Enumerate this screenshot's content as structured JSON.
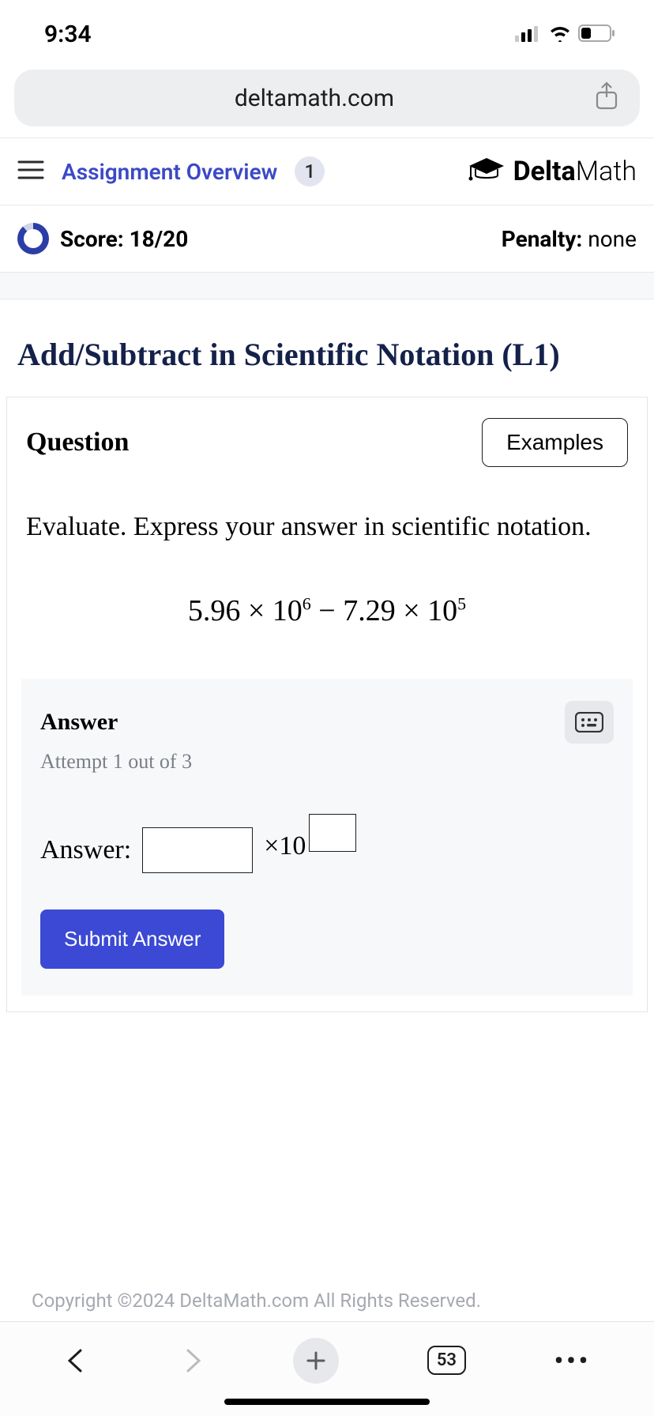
{
  "status": {
    "time": "9:34"
  },
  "browser": {
    "url": "deltamath.com",
    "tab_count": "53"
  },
  "header": {
    "overview_label": "Assignment Overview",
    "badge": "1",
    "brand_bold": "Delta",
    "brand_light": "Math"
  },
  "score": {
    "label_prefix": "Score: ",
    "value": "18/20",
    "penalty_label": "Penalty: ",
    "penalty_value": "none"
  },
  "problem": {
    "title": "Add/Subtract in Scientific Notation (L1)",
    "question_label": "Question",
    "examples_label": "Examples",
    "prompt": "Evaluate. Express your answer in scientific notation.",
    "expr_coef1": "5.96",
    "expr_base1": "10",
    "expr_exp1": "6",
    "expr_op": " − ",
    "expr_coef2": "7.29",
    "expr_base2": "10",
    "expr_exp2": "5"
  },
  "answer": {
    "title": "Answer",
    "attempt": "Attempt 1 out of 3",
    "line_label": "Answer:",
    "times_label": "×10",
    "submit_label": "Submit Answer"
  },
  "footer": {
    "copyright": "Copyright ©2024 DeltaMath.com All Rights Reserved."
  }
}
